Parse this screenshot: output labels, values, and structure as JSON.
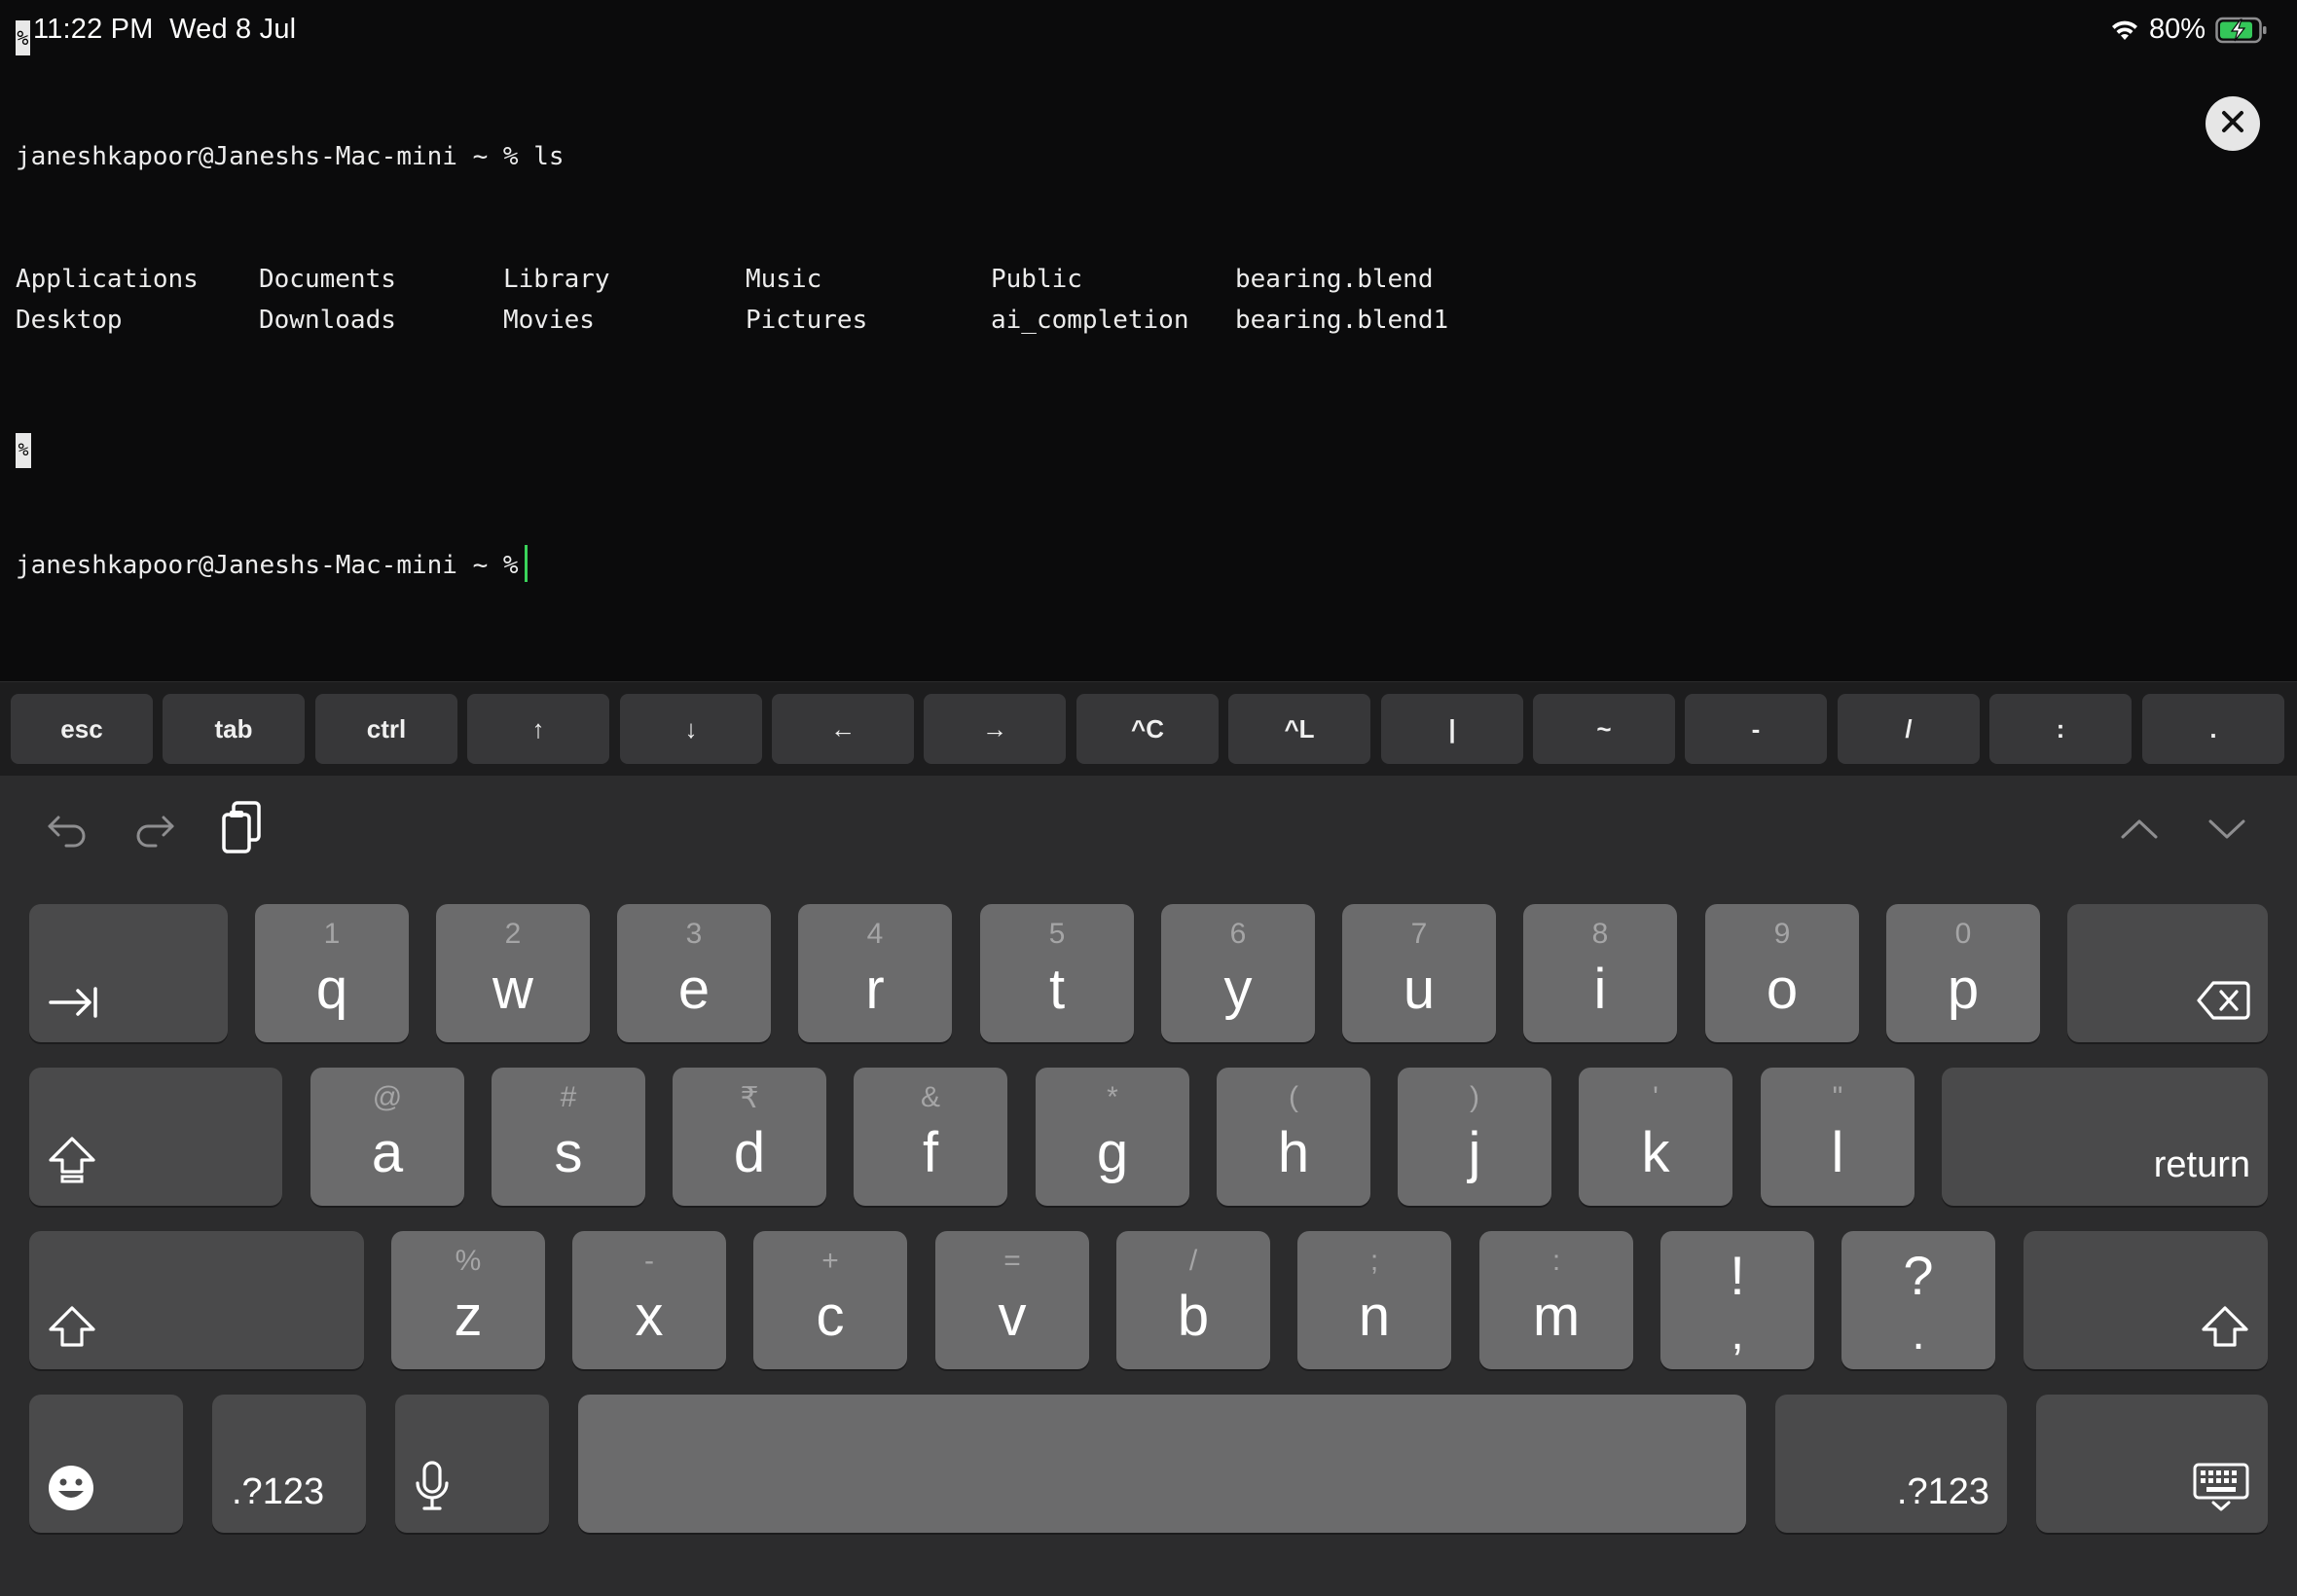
{
  "status_bar": {
    "cursor_glyph": "%",
    "time": "11:22 PM",
    "date": "Wed 8 Jul",
    "battery": "80%"
  },
  "terminal": {
    "prompt_line_1": "janeshkapoor@Janeshs-Mac-mini ~ % ls",
    "ls_output": [
      [
        "Applications",
        "Documents",
        "Library",
        "Music",
        "Public",
        "bearing.blend"
      ],
      [
        "Desktop",
        "Downloads",
        "Movies",
        "Pictures",
        "ai_completion",
        "bearing.blend1"
      ]
    ],
    "percent_marker": "%",
    "prompt_line_2": "janeshkapoor@Janeshs-Mac-mini ~ %"
  },
  "accessory_keys": [
    "esc",
    "tab",
    "ctrl",
    "↑",
    "↓",
    "←",
    "→",
    "^C",
    "^L",
    "|",
    "~",
    "-",
    "/",
    ":",
    "."
  ],
  "keyboard": {
    "row1": [
      {
        "alt": "1",
        "key": "q"
      },
      {
        "alt": "2",
        "key": "w"
      },
      {
        "alt": "3",
        "key": "e"
      },
      {
        "alt": "4",
        "key": "r"
      },
      {
        "alt": "5",
        "key": "t"
      },
      {
        "alt": "6",
        "key": "y"
      },
      {
        "alt": "7",
        "key": "u"
      },
      {
        "alt": "8",
        "key": "i"
      },
      {
        "alt": "9",
        "key": "o"
      },
      {
        "alt": "0",
        "key": "p"
      }
    ],
    "row2": [
      {
        "alt": "@",
        "key": "a"
      },
      {
        "alt": "#",
        "key": "s"
      },
      {
        "alt": "₹",
        "key": "d"
      },
      {
        "alt": "&",
        "key": "f"
      },
      {
        "alt": "*",
        "key": "g"
      },
      {
        "alt": "(",
        "key": "h"
      },
      {
        "alt": ")",
        "key": "j"
      },
      {
        "alt": "'",
        "key": "k"
      },
      {
        "alt": "\"",
        "key": "l"
      }
    ],
    "row3": [
      {
        "alt": "%",
        "key": "z"
      },
      {
        "alt": "-",
        "key": "x"
      },
      {
        "alt": "+",
        "key": "c"
      },
      {
        "alt": "=",
        "key": "v"
      },
      {
        "alt": "/",
        "key": "b"
      },
      {
        "alt": ";",
        "key": "n"
      },
      {
        "alt": ":",
        "key": "m"
      },
      {
        "alt": "!",
        "key": ","
      },
      {
        "alt": "?",
        "key": "."
      }
    ],
    "return_label": "return",
    "numbers_label_left": ".?123",
    "numbers_label_right": ".?123"
  },
  "colors": {
    "background": "#0b0b0c",
    "keyboard_bg": "#2c2c2d",
    "key_light": "#6b6b6c",
    "key_dark": "#4a4a4b",
    "cursor": "#3ad35a",
    "battery_fill": "#34c759"
  },
  "icons": [
    "wifi-icon",
    "battery-charging-icon",
    "close-icon",
    "undo-icon",
    "redo-icon",
    "paste-icon",
    "chevron-up-icon",
    "chevron-down-icon",
    "tab-icon",
    "delete-icon",
    "shift-icon",
    "emoji-icon",
    "microphone-icon",
    "dismiss-keyboard-icon"
  ]
}
